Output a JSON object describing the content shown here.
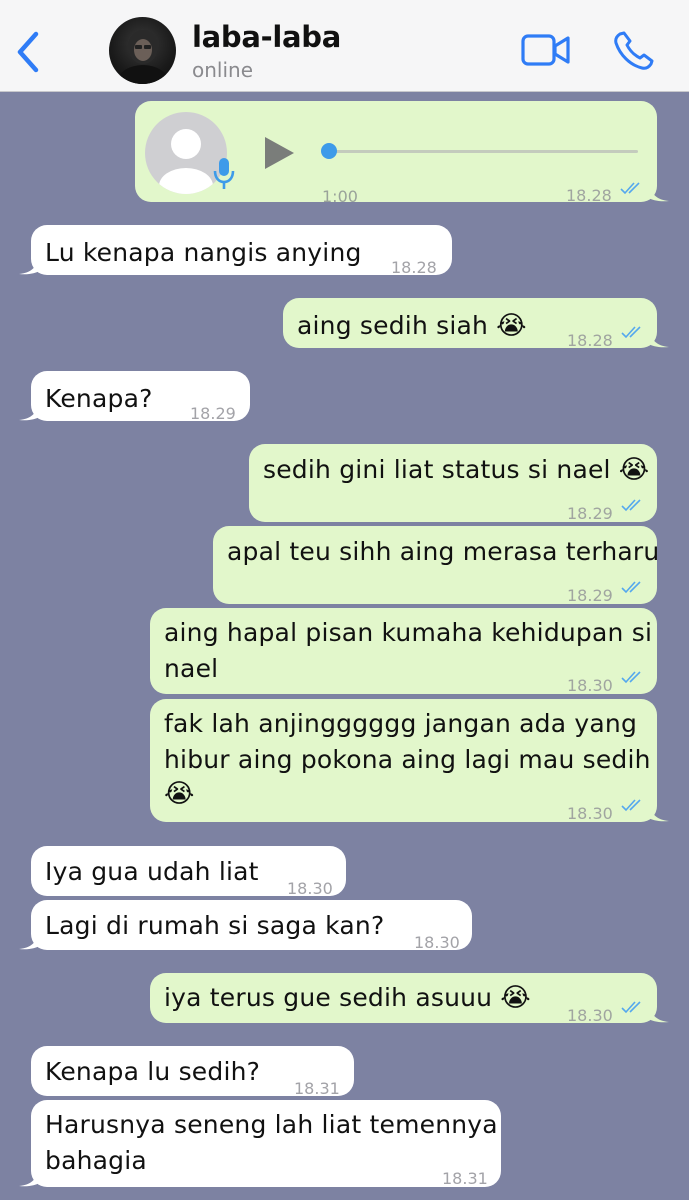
{
  "header": {
    "back_icon": "chevron-left-icon",
    "contact_name": "laba-laba",
    "status": "online",
    "video_icon": "video-camera-icon",
    "call_icon": "phone-icon",
    "accent_color": "#2f7cf6"
  },
  "chat": {
    "background_color": "#7d82a2",
    "outgoing_color": "#e2f7cb",
    "incoming_color": "#ffffff",
    "read_tick_color": "#55a8ee",
    "voice_message": {
      "duration": "1:00",
      "time": "18.28",
      "progress": 0,
      "status": "read"
    },
    "messages": [
      {
        "direction": "in",
        "lines": [
          "Lu kenapa nangis anying"
        ],
        "time": "18.28"
      },
      {
        "direction": "out",
        "lines": [
          "aing sedih siah"
        ],
        "emoji": "😭",
        "time": "18.28",
        "status": "read"
      },
      {
        "direction": "in",
        "lines": [
          "Kenapa?"
        ],
        "time": "18.29"
      },
      {
        "direction": "out",
        "lines": [
          "sedih gini liat status si nael"
        ],
        "emoji": "😭",
        "time": "18.29",
        "status": "read"
      },
      {
        "direction": "out",
        "lines": [
          "apal teu sihh aing merasa terharu"
        ],
        "time": "18.29",
        "status": "read"
      },
      {
        "direction": "out",
        "lines": [
          "aing hapal pisan kumaha kehidupan si",
          "nael"
        ],
        "time": "18.30",
        "status": "read"
      },
      {
        "direction": "out",
        "lines": [
          "fak lah anjingggggg jangan ada yang",
          "hibur aing pokona aing lagi mau sedih"
        ],
        "emoji": "😭",
        "time": "18.30",
        "status": "read"
      },
      {
        "direction": "in",
        "lines": [
          "Iya gua udah liat"
        ],
        "time": "18.30"
      },
      {
        "direction": "in",
        "lines": [
          "Lagi di rumah si saga kan?"
        ],
        "time": "18.30"
      },
      {
        "direction": "out",
        "lines": [
          "iya terus gue sedih asuuu"
        ],
        "emoji": "😭",
        "time": "18.30",
        "status": "read"
      },
      {
        "direction": "in",
        "lines": [
          "Kenapa lu sedih?"
        ],
        "time": "18.31"
      },
      {
        "direction": "in",
        "lines": [
          "Harusnya seneng lah liat temennya",
          "bahagia"
        ],
        "time": "18.31"
      }
    ]
  }
}
